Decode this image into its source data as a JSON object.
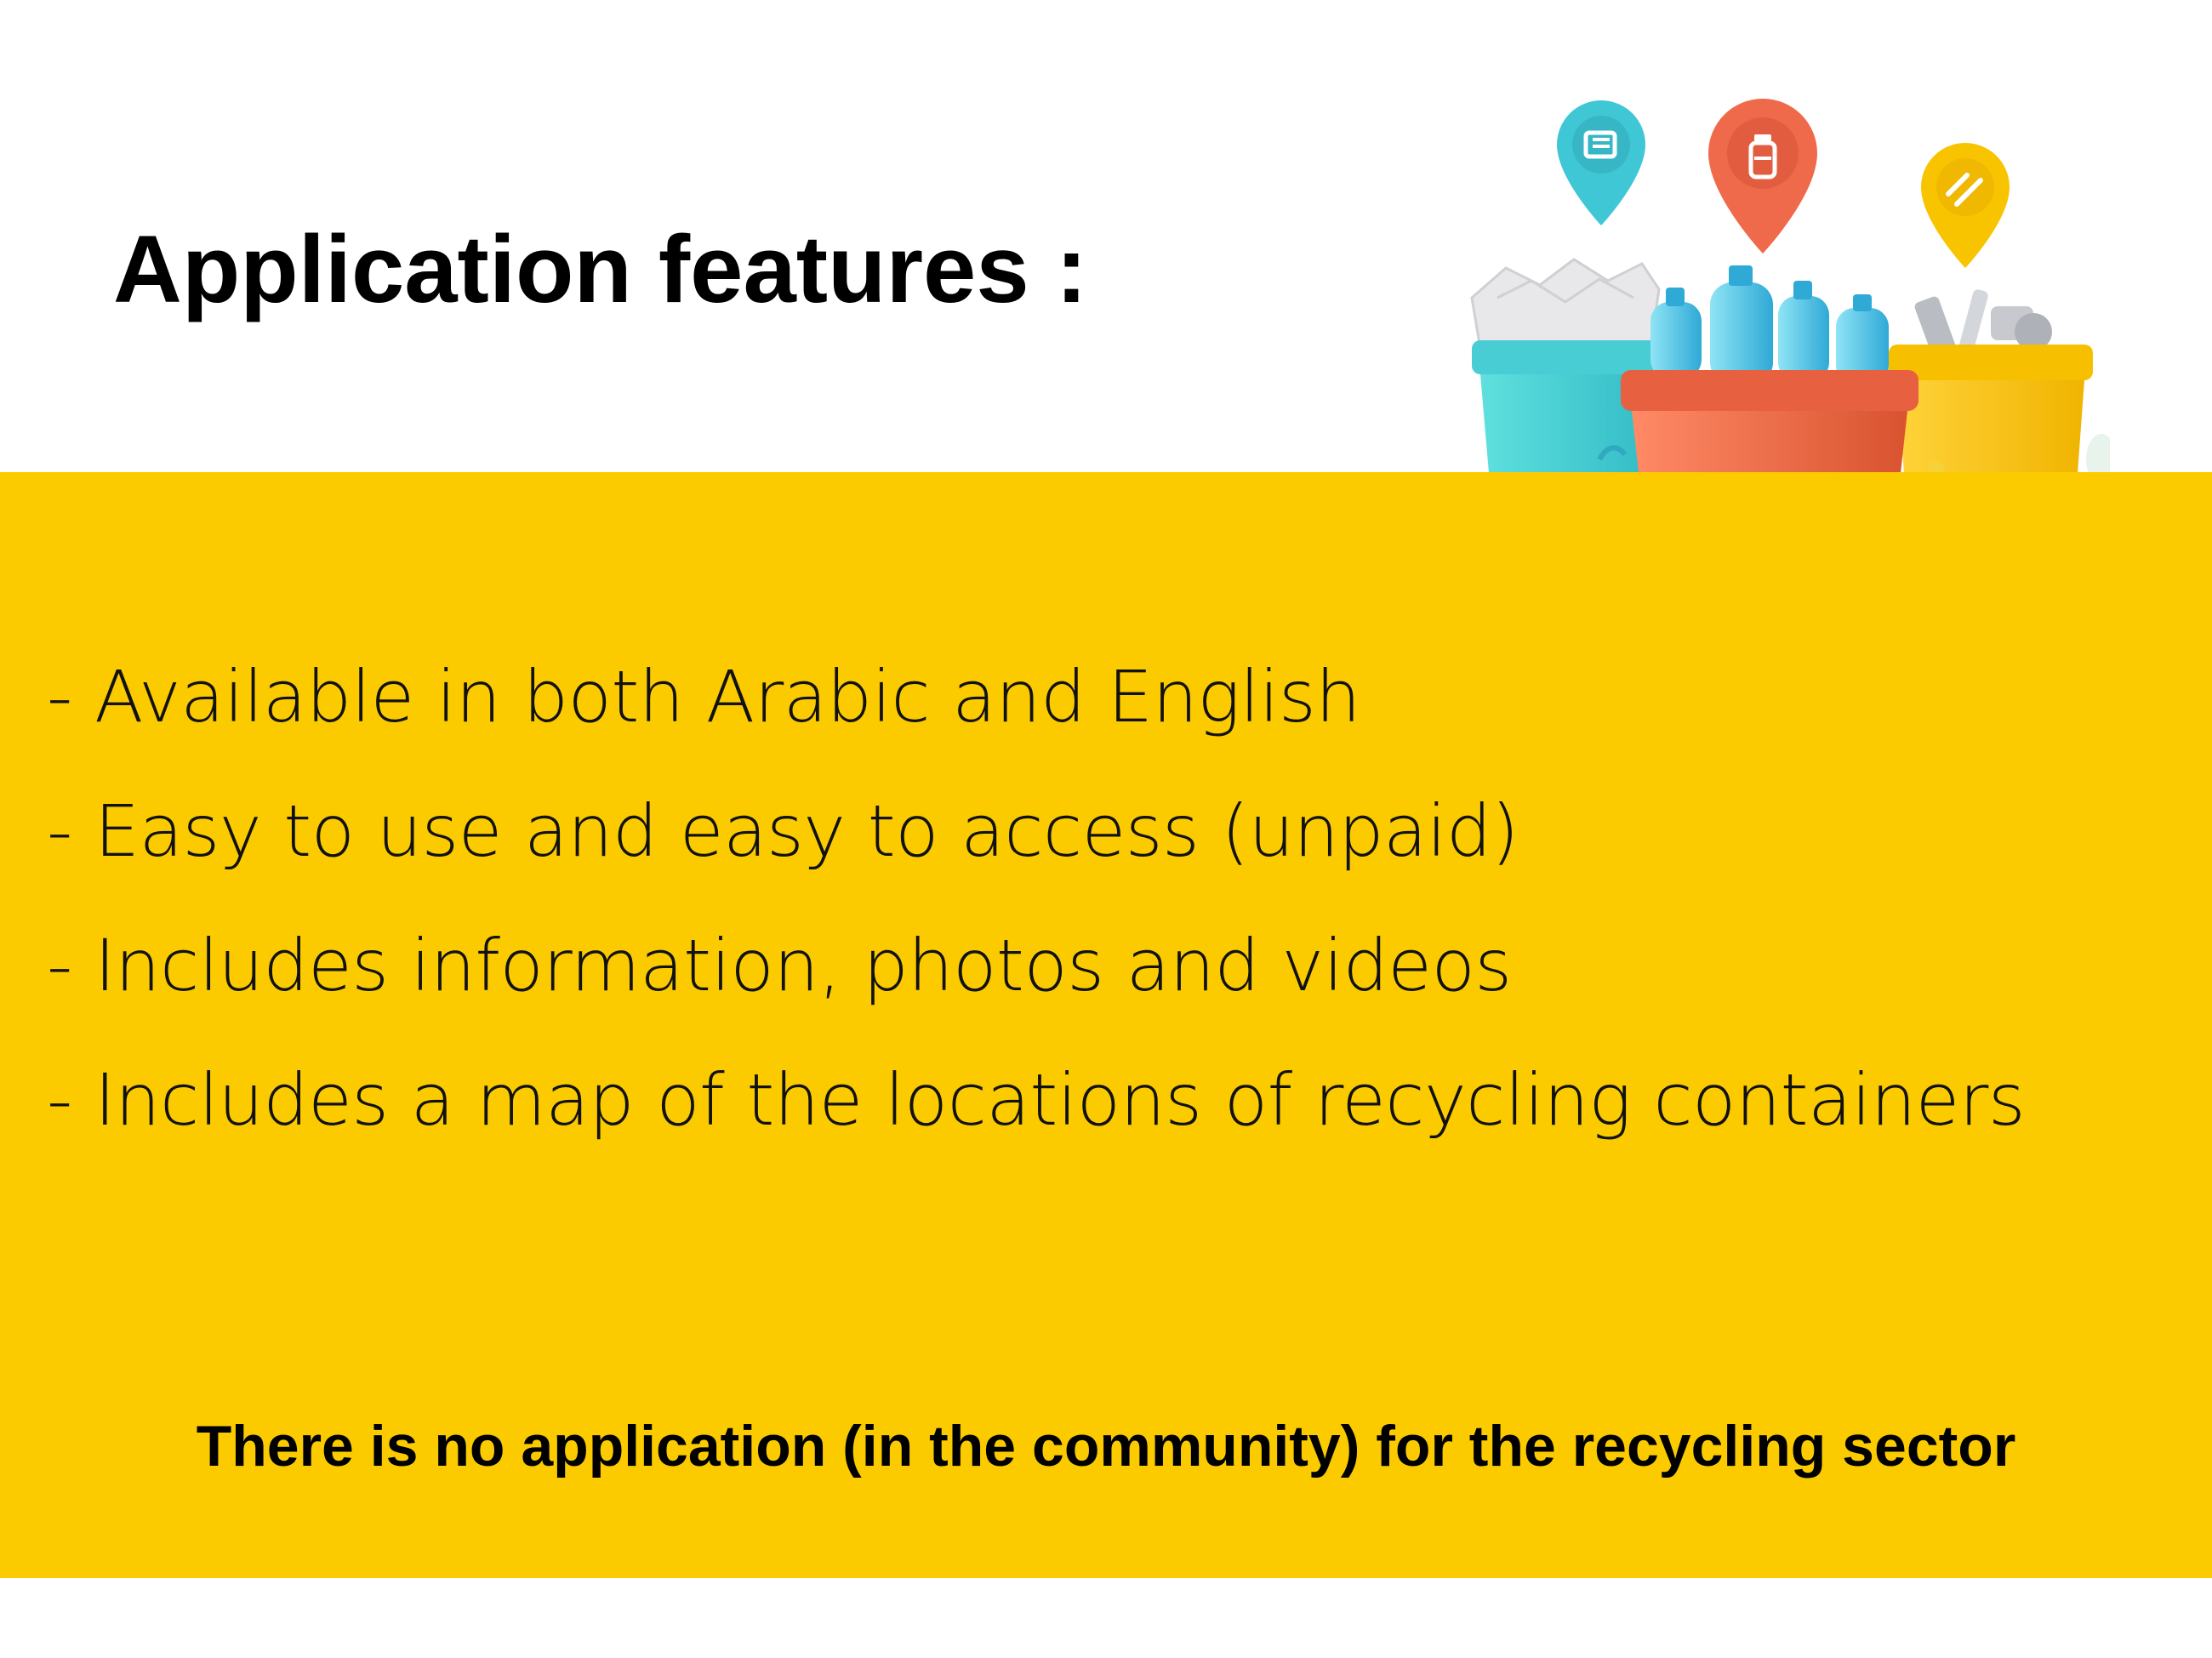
{
  "slide": {
    "title": "Application features :",
    "features": [
      "- Available in both Arabic and English",
      "- Easy to use and easy to access (unpaid)",
      "- Includes information, photos and videos",
      "- Includes a map of the locations of recycling containers"
    ],
    "footer_note": "There is no application (in the community) for the recycling sector"
  },
  "colors": {
    "panel": "#fbcb00",
    "text": "#111111",
    "teal_bin": "#4fd6d8",
    "red_bin": "#ef6a4b",
    "yellow_bin": "#f8c400"
  },
  "illustration": {
    "icons": [
      "paper-pin-icon",
      "bottle-pin-icon",
      "metal-pin-icon"
    ]
  }
}
